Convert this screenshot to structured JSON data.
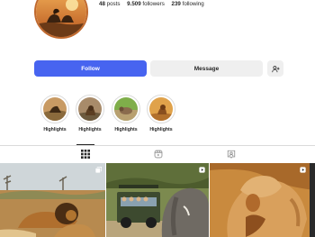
{
  "profile": {
    "stats": [
      {
        "value": "48",
        "label": "posts"
      },
      {
        "value": "9.509",
        "label": "followers"
      },
      {
        "value": "239",
        "label": "following"
      }
    ]
  },
  "actions": {
    "follow_label": "Follow",
    "message_label": "Message",
    "add_icon": "person-add-icon"
  },
  "highlights": [
    {
      "label": "Highlights"
    },
    {
      "label": "Highlights"
    },
    {
      "label": "Highlights"
    },
    {
      "label": "Highlights"
    }
  ],
  "tabs": [
    {
      "icon": "grid-icon",
      "active": true
    },
    {
      "icon": "reels-icon",
      "active": false
    },
    {
      "icon": "tagged-icon",
      "active": false
    }
  ],
  "posts": [
    {
      "type": "carousel",
      "badge_icon": "carousel-icon"
    },
    {
      "type": "video",
      "badge_icon": "reel-icon"
    },
    {
      "type": "video",
      "badge_icon": "reel-icon"
    }
  ],
  "colors": {
    "accent": "#4764f0",
    "secondary_button": "#efefef",
    "text": "#262626",
    "divider": "#dbdbdb"
  }
}
